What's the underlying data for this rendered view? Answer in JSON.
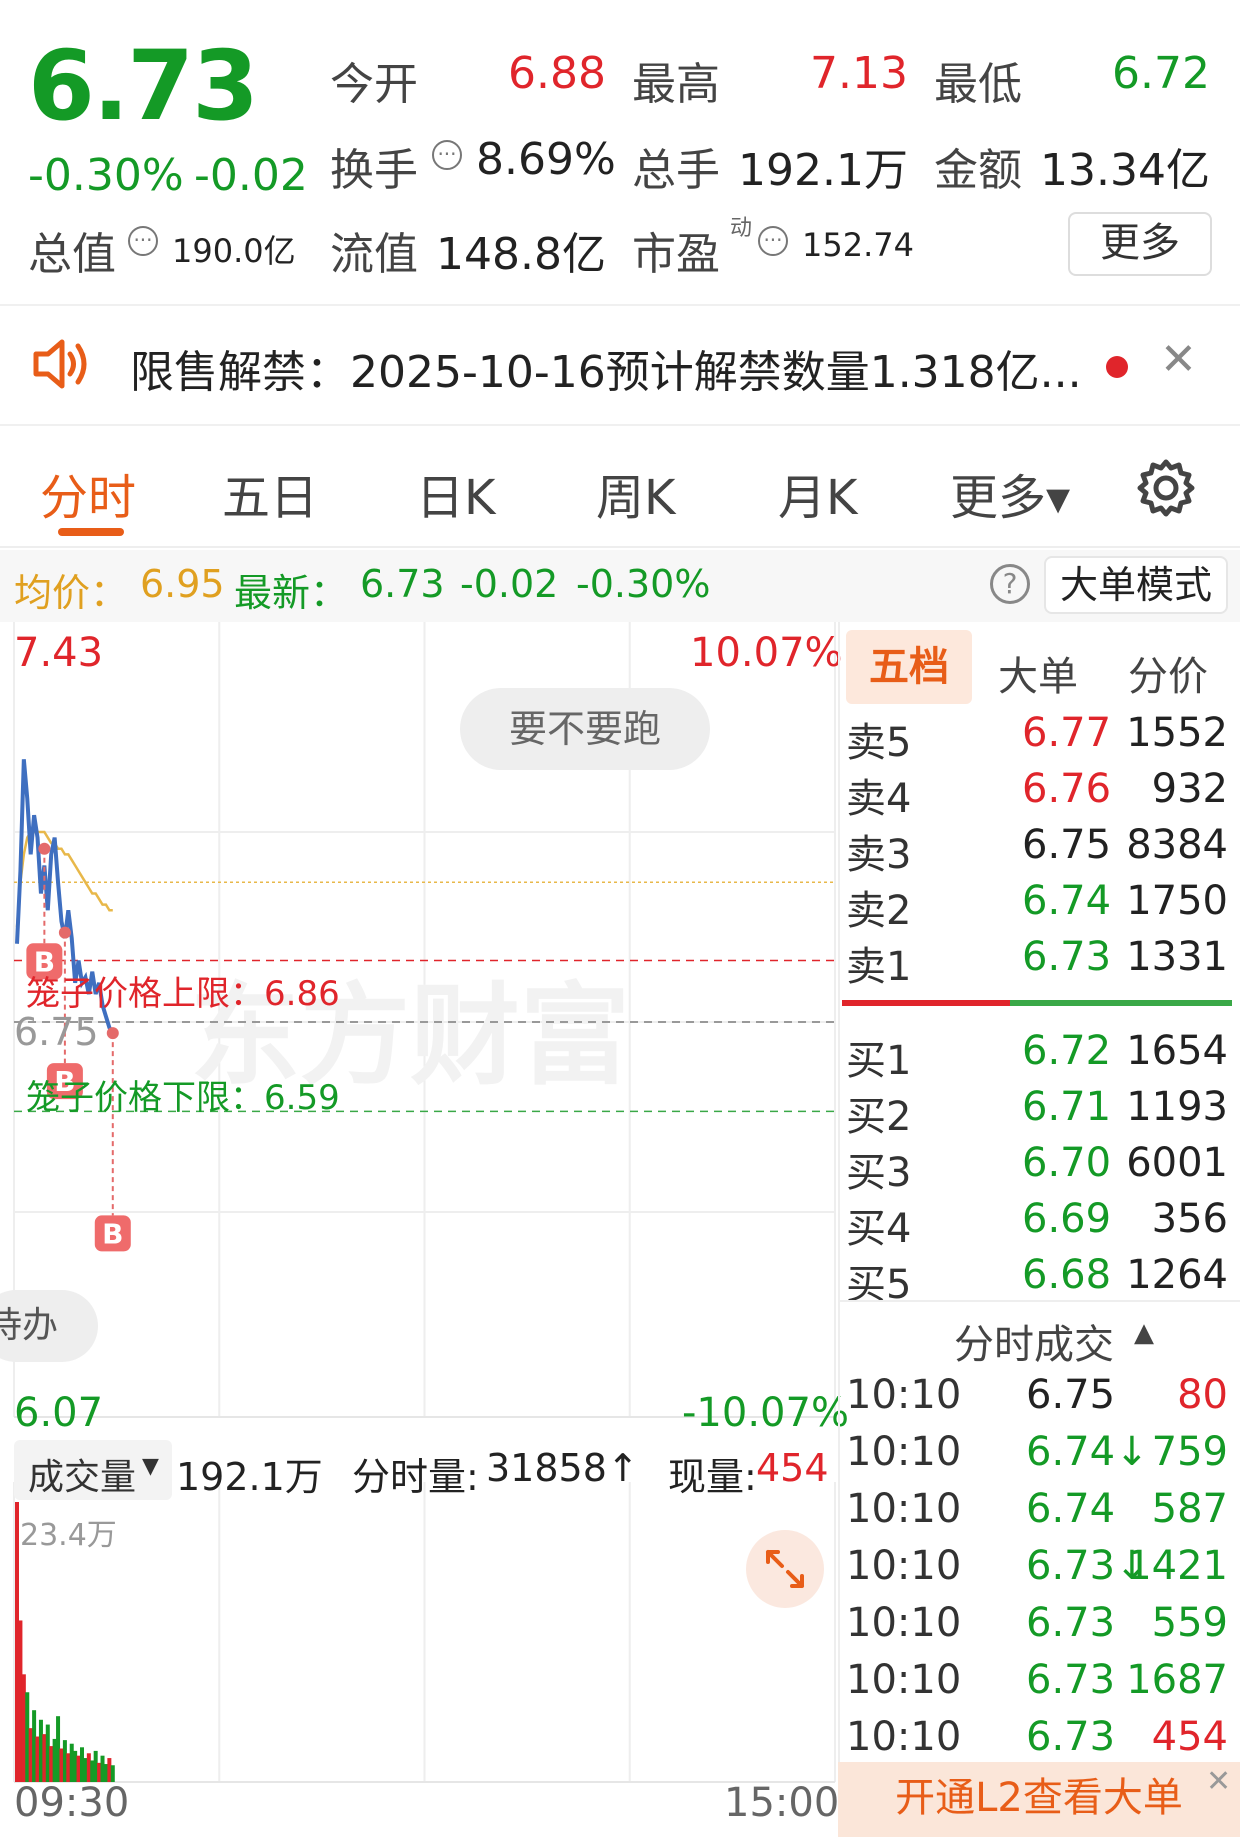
{
  "quote": {
    "price": "6.73",
    "change_pct": "-0.30%",
    "change_abs": "-0.02",
    "open_label": "今开",
    "open": "6.88",
    "high_label": "最高",
    "high": "7.13",
    "low_label": "最低",
    "low": "6.72",
    "turnover_label": "换手",
    "turnover": "8.69%",
    "volume_label": "总手",
    "volume": "192.1万",
    "amount_label": "金额",
    "amount": "13.34亿",
    "mktcap_label": "总值",
    "mktcap": "190.0亿",
    "float_label": "流值",
    "float": "148.8亿",
    "pe_label": "市盈",
    "pe_sup": "动",
    "pe": "152.74",
    "more_button": "更多"
  },
  "notice": {
    "text": "限售解禁：2025-10-16预计解禁数量1.318亿...",
    "close_glyph": "✕"
  },
  "tabs": [
    {
      "label": "分时"
    },
    {
      "label": "五日"
    },
    {
      "label": "日K"
    },
    {
      "label": "周K"
    },
    {
      "label": "月K"
    },
    {
      "label": "更多▾"
    }
  ],
  "avgbar": {
    "avg_label": "均价：",
    "avg": "6.95",
    "latest_label": "最新：",
    "latest": "6.73",
    "chg": "-0.02",
    "chg_pct": "-0.30%",
    "help": "?",
    "mode_button": "大单模式"
  },
  "chart": {
    "top_price": "7.43",
    "top_pct": "10.07%",
    "bottom_price": "6.07",
    "bottom_pct": "-10.07%",
    "mid_price": "6.75",
    "pill_text": "要不要跑",
    "side_pill_text": "待办",
    "cage_upper": "笼子价格上限：6.86",
    "cage_lower": "笼子价格下限：6.59",
    "buy_marker": "B",
    "watermark": "东方财富",
    "price_min": 6.07,
    "price_max": 7.43,
    "prev_close": 6.75,
    "price_series": [
      6.89,
      7.02,
      7.22,
      7.15,
      7.05,
      7.12,
      7.08,
      6.98,
      7.03,
      6.95,
      7.05,
      7.08,
      7.0,
      6.93,
      6.9,
      6.95,
      6.9,
      6.82,
      6.86,
      6.82,
      6.83,
      6.8,
      6.84,
      6.8,
      6.82,
      6.78,
      6.76,
      6.74,
      6.73
    ],
    "avg_series": [
      6.92,
      7.0,
      7.05,
      7.08,
      7.09,
      7.09,
      7.09,
      7.09,
      7.09,
      7.08,
      7.07,
      7.07,
      7.06,
      7.06,
      7.05,
      7.05,
      7.04,
      7.03,
      7.02,
      7.01,
      7.0,
      6.99,
      6.98,
      6.98,
      6.97,
      6.96,
      6.96,
      6.95,
      6.95
    ],
    "buy_points": [
      7.06,
      6.91,
      6.73
    ]
  },
  "volume": {
    "label": "成交量",
    "total": "192.1万",
    "fenshi_label": "分时量:",
    "fenshi": "31858↑",
    "now_label": "现量:",
    "now": "454",
    "max_label": "23.4万",
    "time_start": "09:30",
    "time_end": "15:00",
    "bars": [
      23.4,
      13.5,
      9.0,
      7.5,
      4.5,
      6.0,
      3.8,
      5.2,
      4.0,
      4.8,
      3.0,
      3.6,
      5.5,
      2.8,
      3.5,
      2.4,
      3.2,
      2.6,
      2.2,
      2.9,
      2.0,
      2.4,
      1.8,
      2.6,
      1.6,
      2.2,
      1.5,
      2.0,
      1.4
    ],
    "bar_colors": [
      "red",
      "red",
      "red",
      "green",
      "red",
      "green",
      "red",
      "green",
      "red",
      "green",
      "red",
      "green",
      "green",
      "red",
      "green",
      "red",
      "green",
      "green",
      "red",
      "green",
      "green",
      "red",
      "green",
      "green",
      "red",
      "green",
      "green",
      "red",
      "green"
    ]
  },
  "orderbook": {
    "tabs": [
      "五档",
      "大单",
      "分价"
    ],
    "asks": [
      {
        "label": "卖5",
        "price": "6.77",
        "vol": "1552",
        "color": "red"
      },
      {
        "label": "卖4",
        "price": "6.76",
        "vol": "932",
        "color": "red"
      },
      {
        "label": "卖3",
        "price": "6.75",
        "vol": "8384",
        "color": "gray"
      },
      {
        "label": "卖2",
        "price": "6.74",
        "vol": "1750",
        "color": "green"
      },
      {
        "label": "卖1",
        "price": "6.73",
        "vol": "1331",
        "color": "green"
      }
    ],
    "bids": [
      {
        "label": "买1",
        "price": "6.72",
        "vol": "1654",
        "color": "green"
      },
      {
        "label": "买2",
        "price": "6.71",
        "vol": "1193",
        "color": "green"
      },
      {
        "label": "买3",
        "price": "6.70",
        "vol": "6001",
        "color": "green"
      },
      {
        "label": "买4",
        "price": "6.69",
        "vol": "356",
        "color": "green"
      },
      {
        "label": "买5",
        "price": "6.68",
        "vol": "1264",
        "color": "green"
      }
    ],
    "ticks_title": "分时成交",
    "ticks": [
      {
        "time": "10:10",
        "price": "6.75",
        "pcolor": "gray",
        "vol": "80",
        "vcolor": "red"
      },
      {
        "time": "10:10",
        "price": "6.74↓",
        "pcolor": "green",
        "vol": "759",
        "vcolor": "green"
      },
      {
        "time": "10:10",
        "price": "6.74",
        "pcolor": "green",
        "vol": "587",
        "vcolor": "green"
      },
      {
        "time": "10:10",
        "price": "6.73↓",
        "pcolor": "green",
        "vol": "1421",
        "vcolor": "green"
      },
      {
        "time": "10:10",
        "price": "6.73",
        "pcolor": "green",
        "vol": "559",
        "vcolor": "green"
      },
      {
        "time": "10:10",
        "price": "6.73",
        "pcolor": "green",
        "vol": "1687",
        "vcolor": "green"
      },
      {
        "time": "10:10",
        "price": "6.73",
        "pcolor": "green",
        "vol": "454",
        "vcolor": "red"
      }
    ],
    "l2_banner": "开通L2查看大单"
  }
}
